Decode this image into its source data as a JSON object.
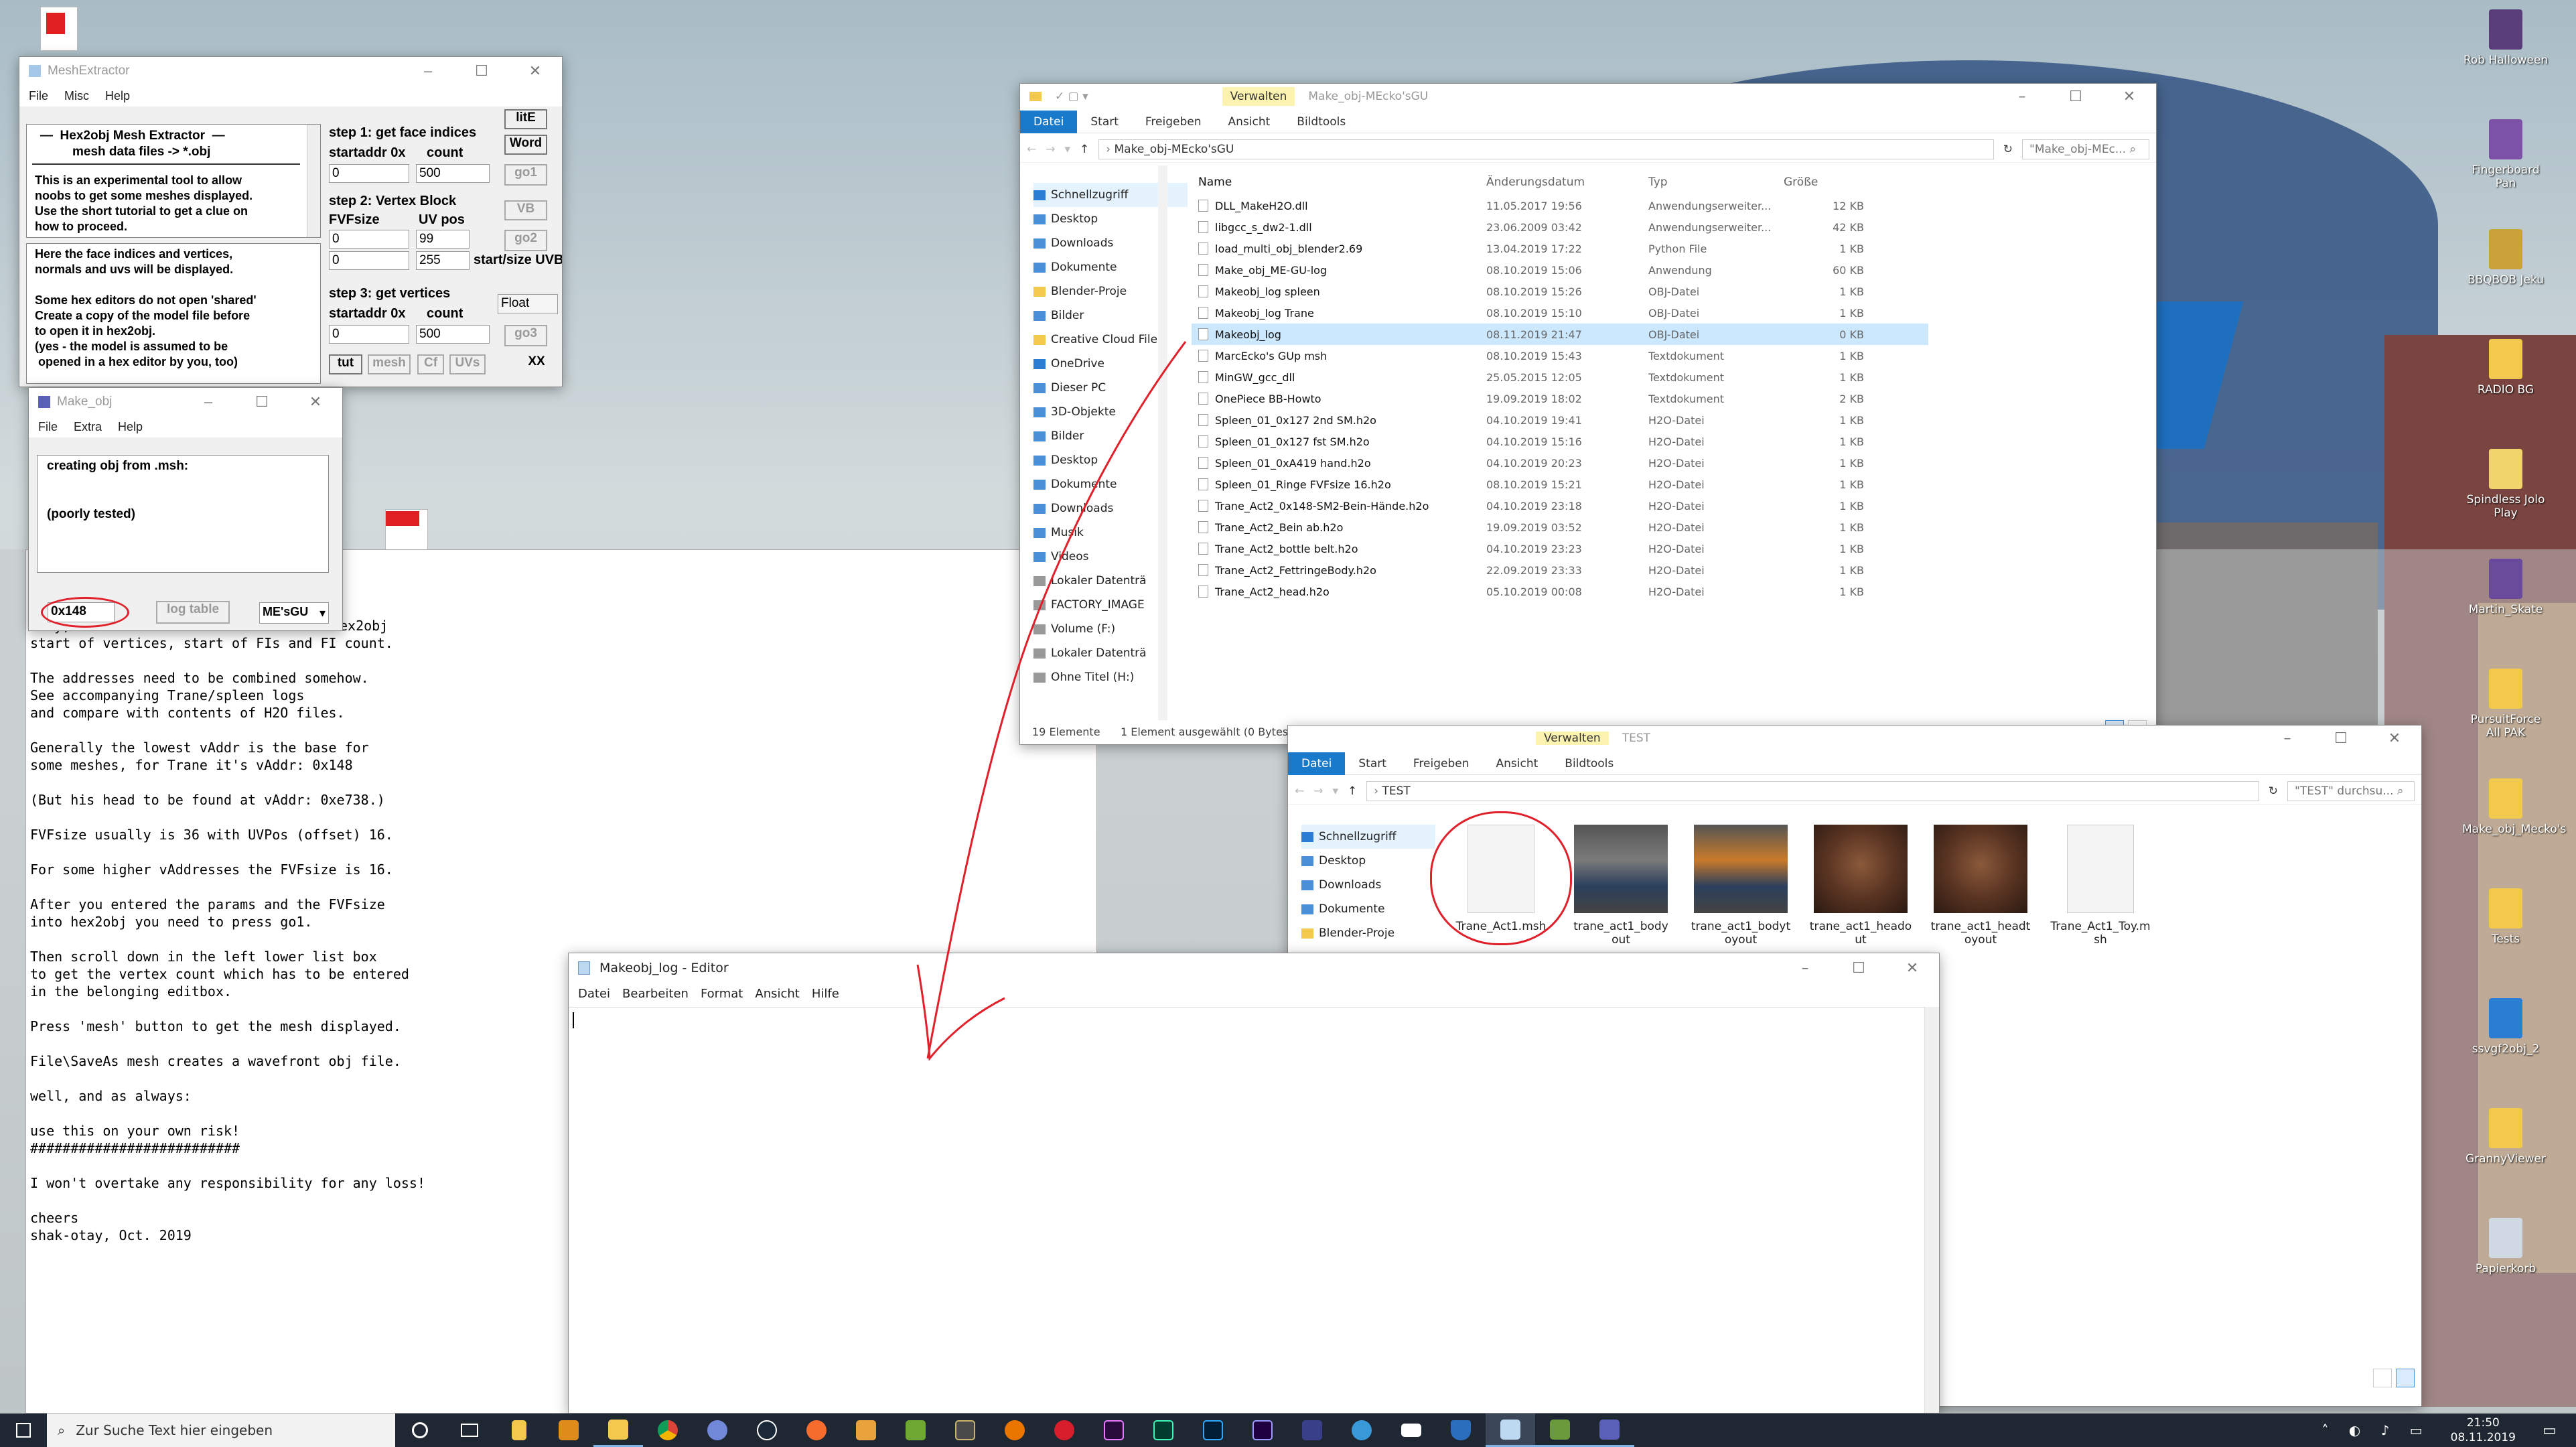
{
  "desktop": {
    "icons_right": [
      {
        "label": "Rob Halloween"
      },
      {
        "label": "Fingerboard Pan"
      },
      {
        "label": "BBQBOB Jeku"
      },
      {
        "label": "RADIO BG"
      },
      {
        "label": "Spindless Jolo Play"
      },
      {
        "label": "Martin_Skate"
      },
      {
        "label": "PursuitForce All PAK"
      },
      {
        "label": "Make_obj_Mecko's"
      },
      {
        "label": "Tests"
      },
      {
        "label": "ssvgf2obj_2"
      },
      {
        "label": "GrannyViewer"
      },
      {
        "label": "Papierkorb"
      }
    ]
  },
  "meshextractor": {
    "title": "MeshExtractor",
    "menu": [
      "File",
      "Misc",
      "Help"
    ],
    "intro_title": "—  Hex2obj Mesh Extractor  —",
    "intro_sub": "mesh data files -> *.obj",
    "intro_text": "This is an experimental tool to allow\nnoobs to get some meshes displayed.\nUse the short tutorial to get a clue on\nhow to proceed.",
    "info_text": "Here the face indices and vertices,\nnormals and uvs will be displayed.\n\nSome hex editors do not open 'shared'\nCreate a copy of the model file before\nto open it in hex2obj.\n(yes - the model is assumed to be\n opened in a hex editor by you, too)",
    "step1": "step 1: get face indices",
    "step2": "step 2: Vertex Block",
    "step3": "step 3: get vertices",
    "startaddr": "startaddr 0x",
    "count": "count",
    "fvfsize": "FVFsize",
    "uvpos": "UV pos",
    "startsize": "start/size UVB",
    "v1_start": "0",
    "v1_count": "500",
    "v2_fvf": "0",
    "v2_uv": "99",
    "v2_b": "0",
    "v2_c": "255",
    "v3_start": "0",
    "v3_count": "500",
    "float": "Float",
    "btn_litE": "litE",
    "btn_word": "Word",
    "btn_go1": "go1",
    "btn_vb": "VB",
    "btn_go2": "go2",
    "btn_go3": "go3",
    "btn_tut": "tut",
    "btn_mesh": "mesh",
    "btn_cf": "Cf",
    "btn_uvs": "UVs",
    "btn_xx": "XX"
  },
  "makeobj": {
    "title": "Make_obj",
    "menu": [
      "File",
      "Extra",
      "Help"
    ],
    "text": "creating obj from .msh:\n\n\n(poorly tested)",
    "value": "0x148",
    "btn_log": "log table",
    "select": "ME'sGU"
  },
  "background_text": "only,\nstart of vertices, start of FIs and FI count.\n\nThe addresses need to be combined somehow.\nSee accompanying Trane/spleen logs\nand compare with contents of H2O files.\n\nGenerally the lowest vAddr is the base for\nsome meshes, for Trane it's vAddr: 0x148\n\n(But his head to be found at vAddr: 0xe738.)\n\nFVFsize usually is 36 with UVPos (offset) 16.\n\nFor some higher vAddresses the FVFsize is 16.\n\nAfter you entered the params and the FVFsize\ninto hex2obj you need to press go1.\n\nThen scroll down in the left lower list box\nto get the vertex count which has to be entered\nin the belonging editbox.\n\nPress 'mesh' button to get the mesh displayed.\n\nFile\\SaveAs mesh creates a wavefront obj file.\n\nwell, and as always:\n\nuse this on your own risk!\n##########################\n\nI won't overtake any responsibility for any loss!\n\ncheers\nshak-otay, Oct. 2019",
  "background_text_prefix": "ex2obj",
  "explorer1": {
    "title": "Make_obj-MEcko'sGU",
    "context_tab": "Verwalten",
    "tabs": [
      "Datei",
      "Start",
      "Freigeben",
      "Ansicht",
      "Bildtools"
    ],
    "path": "Make_obj-MEcko'sGU",
    "search": "\"Make_obj-MEc...",
    "headers": [
      "Name",
      "Änderungsdatum",
      "Typ",
      "Größe"
    ],
    "nav": [
      "Schnellzugriff",
      "Desktop",
      "Downloads",
      "Dokumente",
      "Blender-Proje",
      "Bilder",
      "Creative Cloud File",
      "OneDrive",
      "Dieser PC",
      "3D-Objekte",
      "Bilder",
      "Desktop",
      "Dokumente",
      "Downloads",
      "Musik",
      "Videos",
      "Lokaler Datenträ",
      "FACTORY_IMAGE",
      "Volume (F:)",
      "Lokaler Datenträ",
      "Ohne Titel (H:)"
    ],
    "files": [
      {
        "name": "DLL_MakeH2O.dll",
        "date": "11.05.2017 19:56",
        "type": "Anwendungserweiter...",
        "size": "12 KB"
      },
      {
        "name": "libgcc_s_dw2-1.dll",
        "date": "23.06.2009 03:42",
        "type": "Anwendungserweiter...",
        "size": "42 KB"
      },
      {
        "name": "load_multi_obj_blender2.69",
        "date": "13.04.2019 17:22",
        "type": "Python File",
        "size": "1 KB"
      },
      {
        "name": "Make_obj_ME-GU-log",
        "date": "08.10.2019 15:06",
        "type": "Anwendung",
        "size": "60 KB"
      },
      {
        "name": "Makeobj_log spleen",
        "date": "08.10.2019 15:26",
        "type": "OBJ-Datei",
        "size": "1 KB"
      },
      {
        "name": "Makeobj_log Trane",
        "date": "08.10.2019 15:10",
        "type": "OBJ-Datei",
        "size": "1 KB"
      },
      {
        "name": "Makeobj_log",
        "date": "08.11.2019 21:47",
        "type": "OBJ-Datei",
        "size": "0 KB"
      },
      {
        "name": "MarcEcko's GUp msh",
        "date": "08.10.2019 15:43",
        "type": "Textdokument",
        "size": "1 KB"
      },
      {
        "name": "MinGW_gcc_dll",
        "date": "25.05.2015 12:05",
        "type": "Textdokument",
        "size": "1 KB"
      },
      {
        "name": "OnePiece BB-Howto",
        "date": "19.09.2019 18:02",
        "type": "Textdokument",
        "size": "2 KB"
      },
      {
        "name": "Spleen_01_0x127 2nd SM.h2o",
        "date": "04.10.2019 19:41",
        "type": "H2O-Datei",
        "size": "1 KB"
      },
      {
        "name": "Spleen_01_0x127 fst SM.h2o",
        "date": "04.10.2019 15:16",
        "type": "H2O-Datei",
        "size": "1 KB"
      },
      {
        "name": "Spleen_01_0xA419 hand.h2o",
        "date": "04.10.2019 20:23",
        "type": "H2O-Datei",
        "size": "1 KB"
      },
      {
        "name": "Spleen_01_Ringe FVFsize 16.h2o",
        "date": "08.10.2019 15:21",
        "type": "H2O-Datei",
        "size": "1 KB"
      },
      {
        "name": "Trane_Act2_0x148-SM2-Bein-Hände.h2o",
        "date": "04.10.2019 23:18",
        "type": "H2O-Datei",
        "size": "1 KB"
      },
      {
        "name": "Trane_Act2_Bein ab.h2o",
        "date": "19.09.2019 03:52",
        "type": "H2O-Datei",
        "size": "1 KB"
      },
      {
        "name": "Trane_Act2_bottle belt.h2o",
        "date": "04.10.2019 23:23",
        "type": "H2O-Datei",
        "size": "1 KB"
      },
      {
        "name": "Trane_Act2_FettringeBody.h2o",
        "date": "22.09.2019 23:33",
        "type": "H2O-Datei",
        "size": "1 KB"
      },
      {
        "name": "Trane_Act2_head.h2o",
        "date": "05.10.2019 00:08",
        "type": "H2O-Datei",
        "size": "1 KB"
      }
    ],
    "status_count": "19 Elemente",
    "status_sel": "1 Element ausgewählt (0 Bytes)"
  },
  "explorer2": {
    "title": "TEST",
    "context_tab": "Verwalten",
    "tabs": [
      "Datei",
      "Start",
      "Freigeben",
      "Ansicht",
      "Bildtools"
    ],
    "path": "TEST",
    "search": "\"TEST\" durchsu...",
    "nav": [
      "Schnellzugriff",
      "Desktop",
      "Downloads",
      "Dokumente",
      "Blender-Proje"
    ],
    "thumbs": [
      {
        "label": "Trane_Act1.msh"
      },
      {
        "label": "trane_act1_body\nout"
      },
      {
        "label": "trane_act1_bodyt\noyout"
      },
      {
        "label": "trane_act1_heado\nut"
      },
      {
        "label": "trane_act1_headt\noyout"
      },
      {
        "label": "Trane_Act1_Toy.m\nsh"
      }
    ]
  },
  "editor": {
    "title": "Makeobj_log - Editor",
    "menu": [
      "Datei",
      "Bearbeiten",
      "Format",
      "Ansicht",
      "Hilfe"
    ],
    "content": ""
  },
  "taskbar": {
    "search_placeholder": "Zur Suche Text hier eingeben",
    "time": "21:50",
    "date": "08.11.2019"
  },
  "colors": {
    "accent": "#1979ca",
    "annotation": "#e0202a",
    "taskbar": "#1f2733"
  }
}
